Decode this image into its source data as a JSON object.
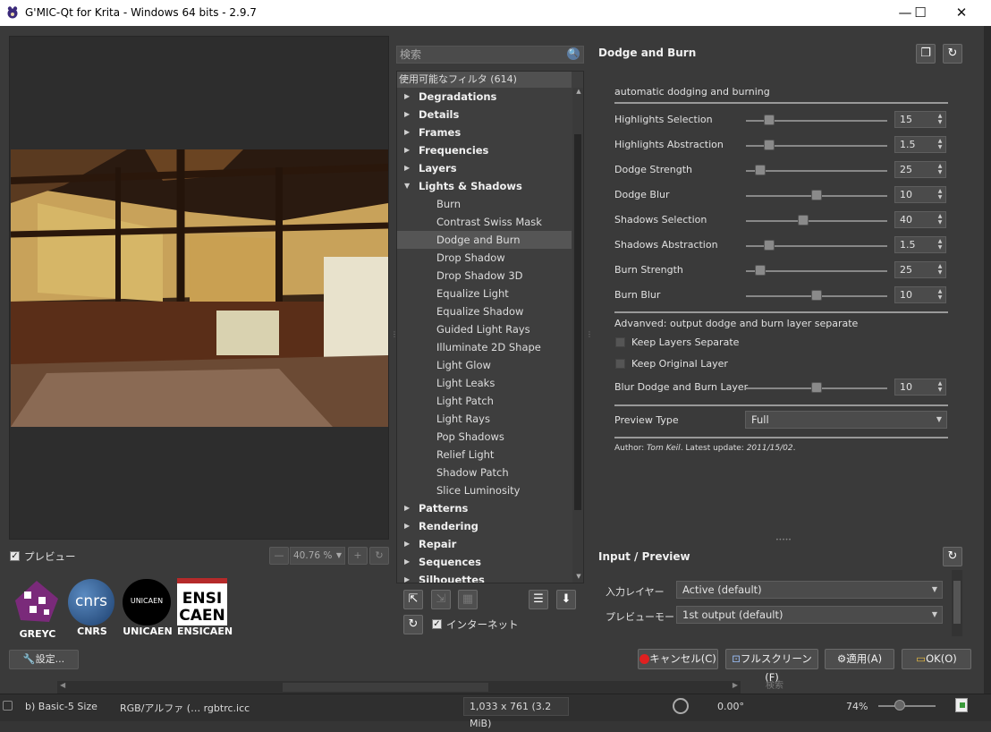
{
  "window": {
    "title": "G'MIC-Qt for Krita - Windows 64 bits - 2.9.7",
    "minimize": "—",
    "maximize": "☐",
    "close": "✕"
  },
  "preview": {
    "checkbox_label": "プレビュー",
    "zoom": "40.76 %",
    "settings_label": "🔧設定..."
  },
  "logos": [
    {
      "name": "GREYC"
    },
    {
      "name": "CNRS",
      "mark": "cnrs"
    },
    {
      "name": "UNICAEN",
      "mark": "UNICAEN"
    },
    {
      "name": "ENSICAEN",
      "mark1": "ENSI",
      "mark2": "CAEN"
    }
  ],
  "filters": {
    "search_placeholder": "検索",
    "header": "使用可能なフィルタ (614)",
    "rows": [
      {
        "label": "Degradations",
        "type": "cat",
        "arrow": "▶"
      },
      {
        "label": "Details",
        "type": "cat",
        "arrow": "▶"
      },
      {
        "label": "Frames",
        "type": "cat",
        "arrow": "▶"
      },
      {
        "label": "Frequencies",
        "type": "cat",
        "arrow": "▶"
      },
      {
        "label": "Layers",
        "type": "cat",
        "arrow": "▶"
      },
      {
        "label": "Lights & Shadows",
        "type": "cat",
        "arrow": "▼"
      },
      {
        "label": "Burn",
        "type": "sub"
      },
      {
        "label": "Contrast Swiss Mask",
        "type": "sub"
      },
      {
        "label": "Dodge and Burn",
        "type": "sub",
        "selected": true
      },
      {
        "label": "Drop Shadow",
        "type": "sub"
      },
      {
        "label": "Drop Shadow 3D",
        "type": "sub"
      },
      {
        "label": "Equalize Light",
        "type": "sub"
      },
      {
        "label": "Equalize Shadow",
        "type": "sub"
      },
      {
        "label": "Guided Light Rays",
        "type": "sub"
      },
      {
        "label": "Illuminate 2D Shape",
        "type": "sub"
      },
      {
        "label": "Light Glow",
        "type": "sub"
      },
      {
        "label": "Light Leaks",
        "type": "sub"
      },
      {
        "label": "Light Patch",
        "type": "sub"
      },
      {
        "label": "Light Rays",
        "type": "sub"
      },
      {
        "label": "Pop Shadows",
        "type": "sub"
      },
      {
        "label": "Relief Light",
        "type": "sub"
      },
      {
        "label": "Shadow Patch",
        "type": "sub"
      },
      {
        "label": "Slice Luminosity",
        "type": "sub"
      },
      {
        "label": "Patterns",
        "type": "cat",
        "arrow": "▶"
      },
      {
        "label": "Rendering",
        "type": "cat",
        "arrow": "▶"
      },
      {
        "label": "Repair",
        "type": "cat",
        "arrow": "▶"
      },
      {
        "label": "Sequences",
        "type": "cat",
        "arrow": "▶"
      },
      {
        "label": "Silhouettes",
        "type": "cat",
        "arrow": "▶"
      }
    ],
    "internet_label": "インターネット"
  },
  "params": {
    "title": "Dodge and Burn",
    "subtitle": "automatic dodging and burning",
    "sliders": [
      {
        "label": "Highlights Selection",
        "value": "15",
        "level": 0.14
      },
      {
        "label": "Highlights Abstraction",
        "value": "1.5",
        "level": 0.14
      },
      {
        "label": "Dodge Strength",
        "value": "25",
        "level": 0.07
      },
      {
        "label": "Dodge Blur",
        "value": "10",
        "level": 0.5
      },
      {
        "label": "Shadows Selection",
        "value": "40",
        "level": 0.4
      },
      {
        "label": "Shadows Abstraction",
        "value": "1.5",
        "level": 0.14
      },
      {
        "label": "Burn Strength",
        "value": "25",
        "level": 0.07
      },
      {
        "label": "Burn Blur",
        "value": "10",
        "level": 0.5
      }
    ],
    "advanced_note": "Advanved: output dodge and burn layer separate",
    "keep_separate": "Keep Layers Separate",
    "keep_original": "Keep Original Layer",
    "blur_layer": {
      "label": "Blur Dodge and Burn Layer",
      "value": "10",
      "level": 0.5
    },
    "preview_type_label": "Preview Type",
    "preview_type_value": "Full",
    "author_prefix": "Author: ",
    "author_name": "Tom Keil",
    "author_mid": ". Latest update: ",
    "author_date": "2011/15/02",
    "author_end": "."
  },
  "io": {
    "title": "Input / Preview",
    "input_layer_label": "入力レイヤー",
    "input_layer_value": "Active (default)",
    "preview_mode_label": "プレビューモード",
    "preview_mode_value": "1st output (default)"
  },
  "buttons": {
    "cancel": "キャンセル(C)",
    "fullscreen": "フルスクリーン(F)",
    "apply": "適用(A)",
    "ok": "OK(O)"
  },
  "statusbar": {
    "brush": "b) Basic-5 Size",
    "colorspace": "RGB/アルファ (… rgbtrc.icc",
    "dims": "1,033 x 761 (3.2 MiB)",
    "angle": "0.00°",
    "zoom": "74%",
    "search_ghost": "検索"
  }
}
